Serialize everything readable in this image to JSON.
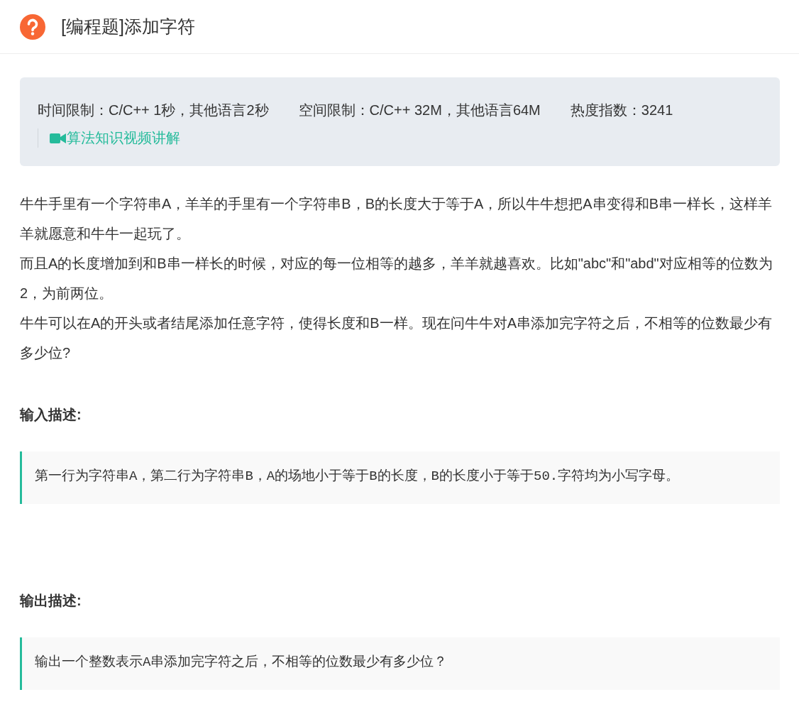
{
  "header": {
    "title": "[编程题]添加字符"
  },
  "info": {
    "limits": [
      "时间限制：C/C++ 1秒，其他语言2秒",
      "空间限制：C/C++ 32M，其他语言64M",
      "热度指数：3241"
    ],
    "video_link": "算法知识视频讲解"
  },
  "description": [
    "牛牛手里有一个字符串A，羊羊的手里有一个字符串B，B的长度大于等于A，所以牛牛想把A串变得和B串一样长，这样羊羊就愿意和牛牛一起玩了。",
    "而且A的长度增加到和B串一样长的时候，对应的每一位相等的越多，羊羊就越喜欢。比如\"abc\"和\"abd\"对应相等的位数为2，为前两位。",
    "牛牛可以在A的开头或者结尾添加任意字符，使得长度和B一样。现在问牛牛对A串添加完字符之后，不相等的位数最少有多少位?"
  ],
  "sections": [
    {
      "heading": "输入描述:",
      "body": "第一行为字符串A，第二行为字符串B，A的场地小于等于B的长度，B的长度小于等于50.字符均为小写字母。"
    },
    {
      "heading": "输出描述:",
      "body": "输出一个整数表示A串添加完字符之后，不相等的位数最少有多少位？"
    }
  ]
}
